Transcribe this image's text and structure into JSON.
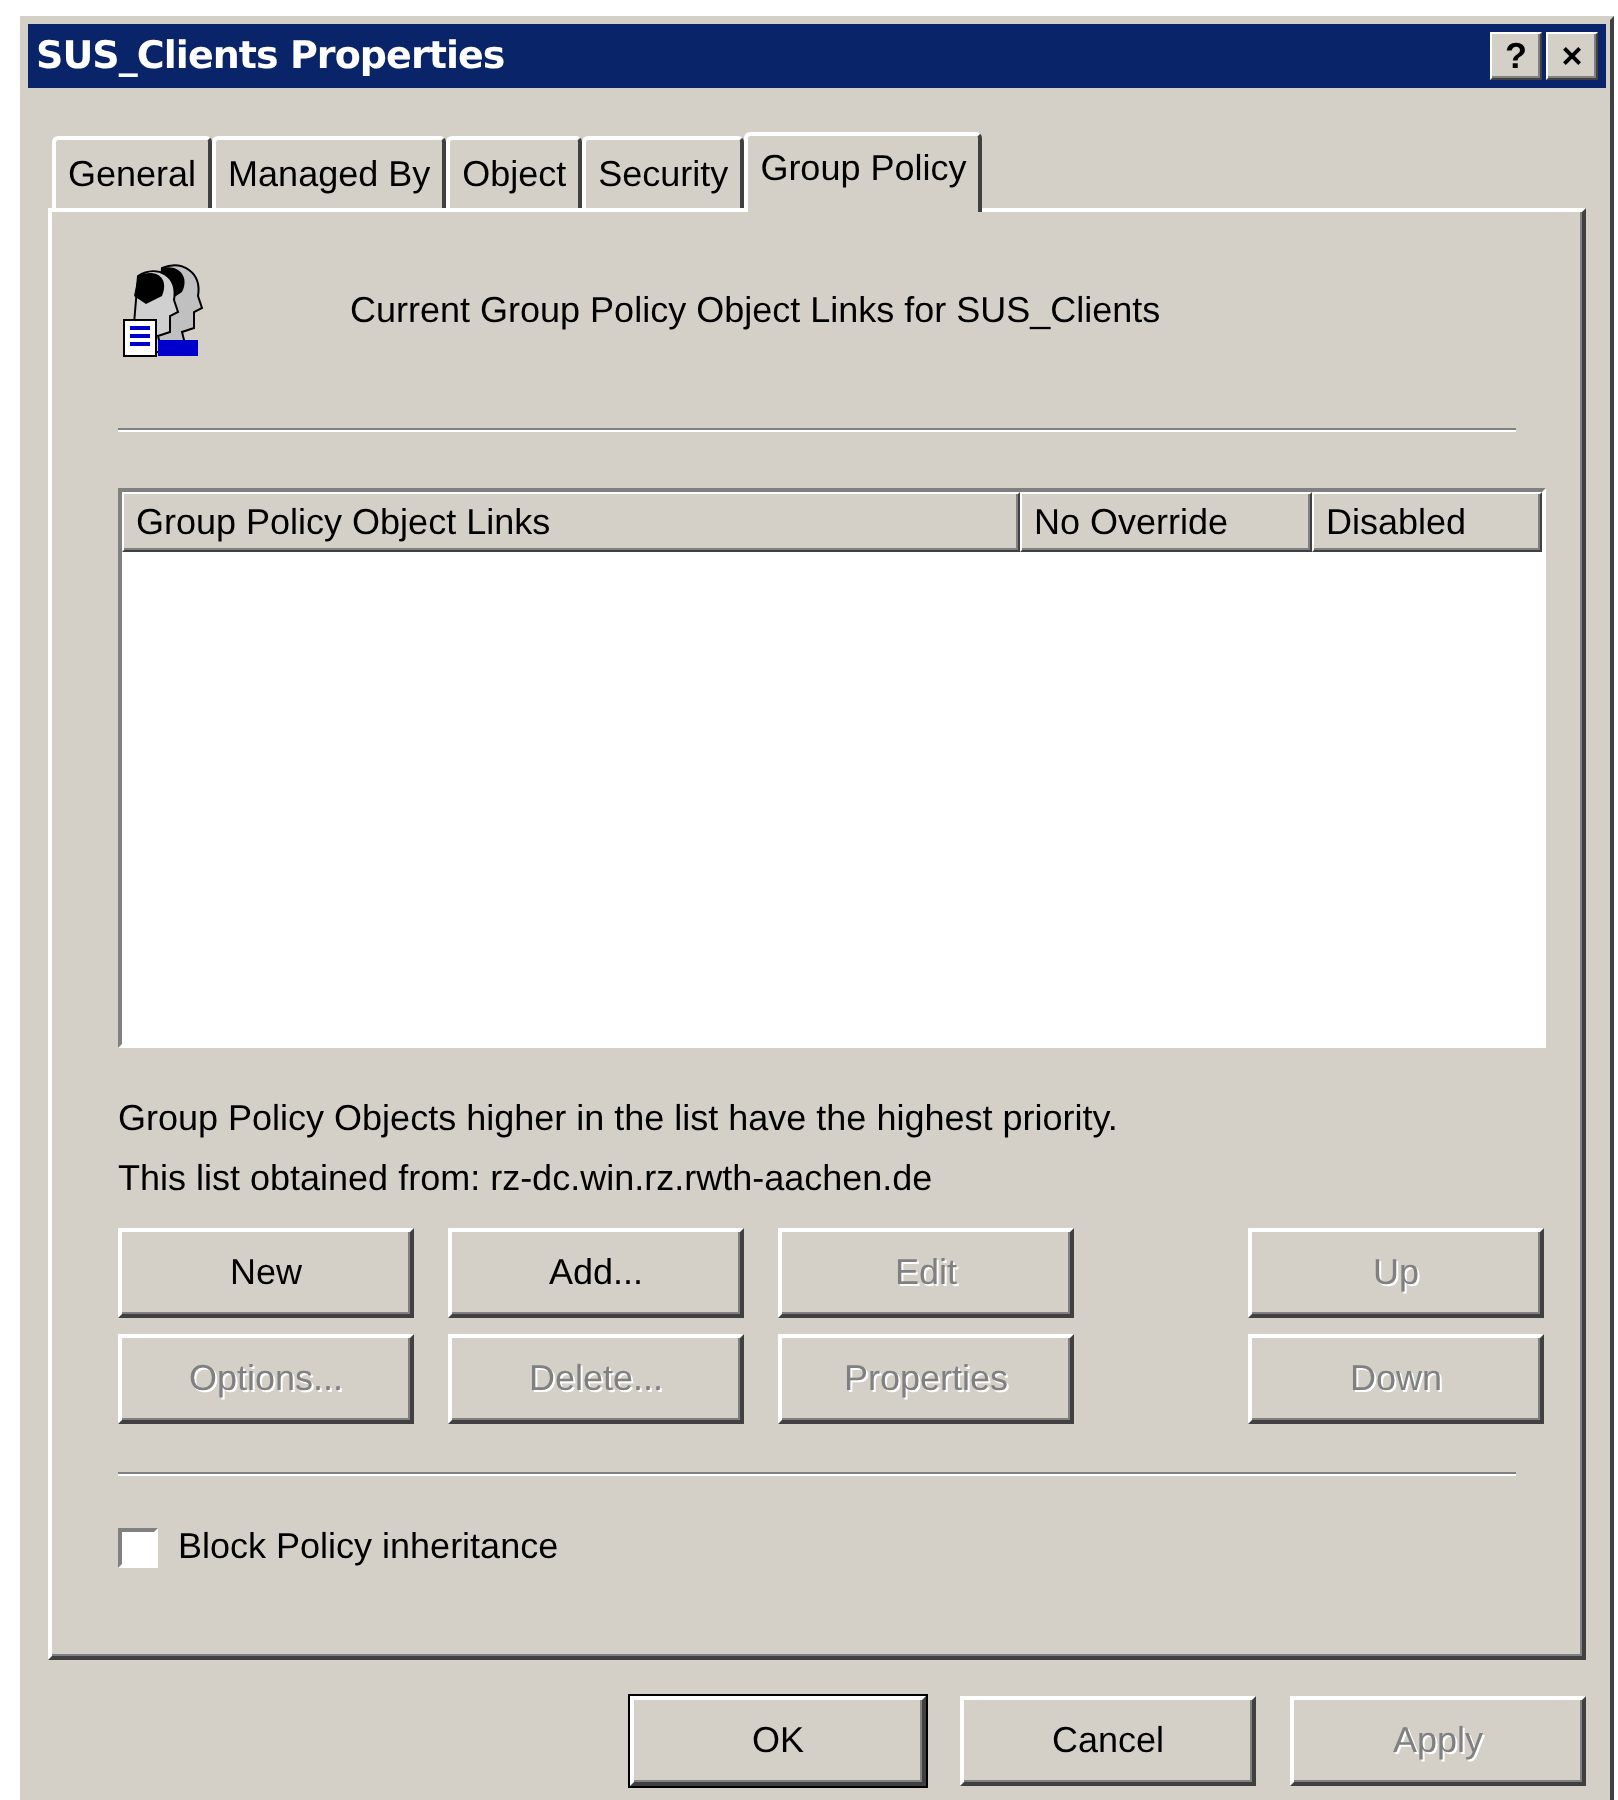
{
  "window": {
    "title": "SUS_Clients Properties",
    "title_buttons": [
      "?",
      "×"
    ]
  },
  "tabs": [
    {
      "label": "General",
      "selected": false
    },
    {
      "label": "Managed By",
      "selected": false
    },
    {
      "label": "Object",
      "selected": false
    },
    {
      "label": "Security",
      "selected": false
    },
    {
      "label": "Group Policy",
      "selected": true
    }
  ],
  "header": "Current Group Policy Object Links for SUS_Clients",
  "list": {
    "columns": [
      "Group Policy Object Links",
      "No Override",
      "Disabled"
    ]
  },
  "notes": [
    "Group Policy Objects higher in the list have the highest priority.",
    "This list obtained from: rz-dc.win.rz.rwth-aachen.de"
  ],
  "buttons": [
    {
      "label": "New",
      "disabled": false
    },
    {
      "label": "Add...",
      "disabled": false
    },
    {
      "label": "Edit",
      "disabled": true
    },
    {
      "label": "Up",
      "disabled": true
    },
    {
      "label": "Options...",
      "disabled": true
    },
    {
      "label": "Delete...",
      "disabled": true
    },
    {
      "label": "Properties",
      "disabled": true
    },
    {
      "label": "Down",
      "disabled": true
    }
  ],
  "block_inheritance": {
    "label": "Block Policy inheritance",
    "checked": false
  },
  "dialog_buttons": [
    {
      "label": "OK",
      "disabled": false,
      "default": true
    },
    {
      "label": "Cancel",
      "disabled": false,
      "default": false
    },
    {
      "label": "Apply",
      "disabled": true,
      "default": false
    }
  ]
}
